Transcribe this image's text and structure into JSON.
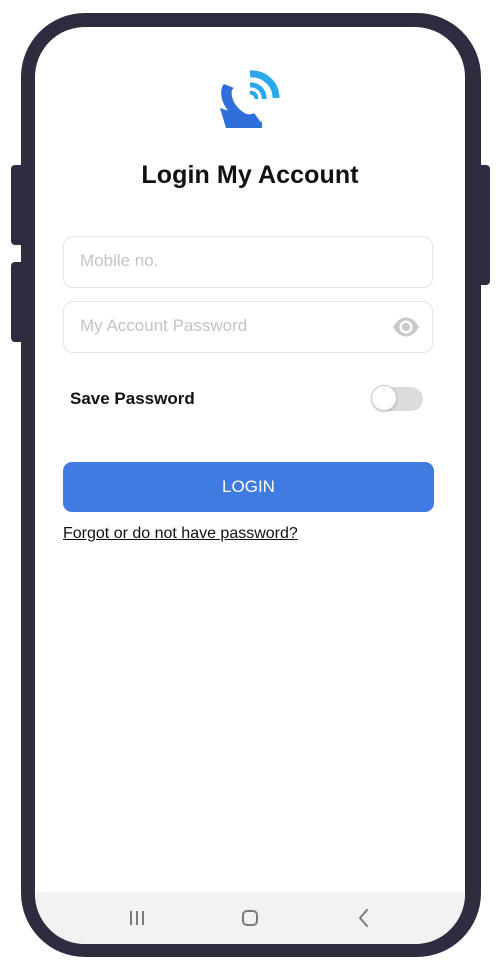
{
  "app": {
    "title": "Login My Account"
  },
  "form": {
    "mobile_placeholder": "Mobile no.",
    "password_placeholder": "My Account Password",
    "save_password_label": "Save Password",
    "save_password_enabled": false,
    "login_label": "LOGIN",
    "forgot_link": "Forgot or do not have password?"
  },
  "icons": {
    "logo": "phone-signal-logo-icon",
    "password_visibility": "eye-icon",
    "nav_recents": "recents-icon",
    "nav_home": "home-icon",
    "nav_back": "back-icon"
  },
  "colors": {
    "primary": "#3f7be0",
    "logo_dark": "#2f6fdc",
    "logo_light": "#29a9ea",
    "device_frame": "#2e2d3f",
    "toggle_off_track": "#dcdcdc",
    "input_border": "#e4e4e4",
    "placeholder": "#c4c4c4"
  }
}
